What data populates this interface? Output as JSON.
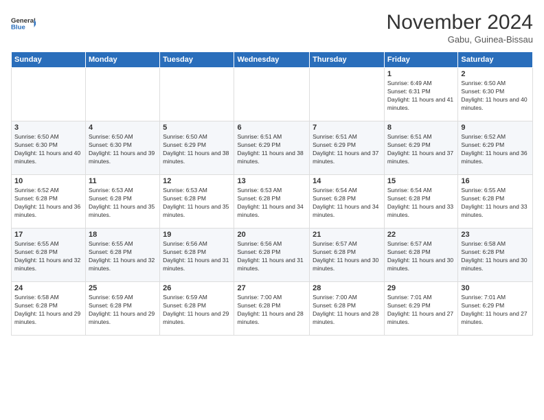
{
  "logo": {
    "line1": "General",
    "line2": "Blue"
  },
  "title": "November 2024",
  "subtitle": "Gabu, Guinea-Bissau",
  "days_header": [
    "Sunday",
    "Monday",
    "Tuesday",
    "Wednesday",
    "Thursday",
    "Friday",
    "Saturday"
  ],
  "weeks": [
    [
      {
        "num": "",
        "info": ""
      },
      {
        "num": "",
        "info": ""
      },
      {
        "num": "",
        "info": ""
      },
      {
        "num": "",
        "info": ""
      },
      {
        "num": "",
        "info": ""
      },
      {
        "num": "1",
        "info": "Sunrise: 6:49 AM\nSunset: 6:31 PM\nDaylight: 11 hours and 41 minutes."
      },
      {
        "num": "2",
        "info": "Sunrise: 6:50 AM\nSunset: 6:30 PM\nDaylight: 11 hours and 40 minutes."
      }
    ],
    [
      {
        "num": "3",
        "info": "Sunrise: 6:50 AM\nSunset: 6:30 PM\nDaylight: 11 hours and 40 minutes."
      },
      {
        "num": "4",
        "info": "Sunrise: 6:50 AM\nSunset: 6:30 PM\nDaylight: 11 hours and 39 minutes."
      },
      {
        "num": "5",
        "info": "Sunrise: 6:50 AM\nSunset: 6:29 PM\nDaylight: 11 hours and 38 minutes."
      },
      {
        "num": "6",
        "info": "Sunrise: 6:51 AM\nSunset: 6:29 PM\nDaylight: 11 hours and 38 minutes."
      },
      {
        "num": "7",
        "info": "Sunrise: 6:51 AM\nSunset: 6:29 PM\nDaylight: 11 hours and 37 minutes."
      },
      {
        "num": "8",
        "info": "Sunrise: 6:51 AM\nSunset: 6:29 PM\nDaylight: 11 hours and 37 minutes."
      },
      {
        "num": "9",
        "info": "Sunrise: 6:52 AM\nSunset: 6:29 PM\nDaylight: 11 hours and 36 minutes."
      }
    ],
    [
      {
        "num": "10",
        "info": "Sunrise: 6:52 AM\nSunset: 6:28 PM\nDaylight: 11 hours and 36 minutes."
      },
      {
        "num": "11",
        "info": "Sunrise: 6:53 AM\nSunset: 6:28 PM\nDaylight: 11 hours and 35 minutes."
      },
      {
        "num": "12",
        "info": "Sunrise: 6:53 AM\nSunset: 6:28 PM\nDaylight: 11 hours and 35 minutes."
      },
      {
        "num": "13",
        "info": "Sunrise: 6:53 AM\nSunset: 6:28 PM\nDaylight: 11 hours and 34 minutes."
      },
      {
        "num": "14",
        "info": "Sunrise: 6:54 AM\nSunset: 6:28 PM\nDaylight: 11 hours and 34 minutes."
      },
      {
        "num": "15",
        "info": "Sunrise: 6:54 AM\nSunset: 6:28 PM\nDaylight: 11 hours and 33 minutes."
      },
      {
        "num": "16",
        "info": "Sunrise: 6:55 AM\nSunset: 6:28 PM\nDaylight: 11 hours and 33 minutes."
      }
    ],
    [
      {
        "num": "17",
        "info": "Sunrise: 6:55 AM\nSunset: 6:28 PM\nDaylight: 11 hours and 32 minutes."
      },
      {
        "num": "18",
        "info": "Sunrise: 6:55 AM\nSunset: 6:28 PM\nDaylight: 11 hours and 32 minutes."
      },
      {
        "num": "19",
        "info": "Sunrise: 6:56 AM\nSunset: 6:28 PM\nDaylight: 11 hours and 31 minutes."
      },
      {
        "num": "20",
        "info": "Sunrise: 6:56 AM\nSunset: 6:28 PM\nDaylight: 11 hours and 31 minutes."
      },
      {
        "num": "21",
        "info": "Sunrise: 6:57 AM\nSunset: 6:28 PM\nDaylight: 11 hours and 30 minutes."
      },
      {
        "num": "22",
        "info": "Sunrise: 6:57 AM\nSunset: 6:28 PM\nDaylight: 11 hours and 30 minutes."
      },
      {
        "num": "23",
        "info": "Sunrise: 6:58 AM\nSunset: 6:28 PM\nDaylight: 11 hours and 30 minutes."
      }
    ],
    [
      {
        "num": "24",
        "info": "Sunrise: 6:58 AM\nSunset: 6:28 PM\nDaylight: 11 hours and 29 minutes."
      },
      {
        "num": "25",
        "info": "Sunrise: 6:59 AM\nSunset: 6:28 PM\nDaylight: 11 hours and 29 minutes."
      },
      {
        "num": "26",
        "info": "Sunrise: 6:59 AM\nSunset: 6:28 PM\nDaylight: 11 hours and 29 minutes."
      },
      {
        "num": "27",
        "info": "Sunrise: 7:00 AM\nSunset: 6:28 PM\nDaylight: 11 hours and 28 minutes."
      },
      {
        "num": "28",
        "info": "Sunrise: 7:00 AM\nSunset: 6:28 PM\nDaylight: 11 hours and 28 minutes."
      },
      {
        "num": "29",
        "info": "Sunrise: 7:01 AM\nSunset: 6:29 PM\nDaylight: 11 hours and 27 minutes."
      },
      {
        "num": "30",
        "info": "Sunrise: 7:01 AM\nSunset: 6:29 PM\nDaylight: 11 hours and 27 minutes."
      }
    ]
  ]
}
